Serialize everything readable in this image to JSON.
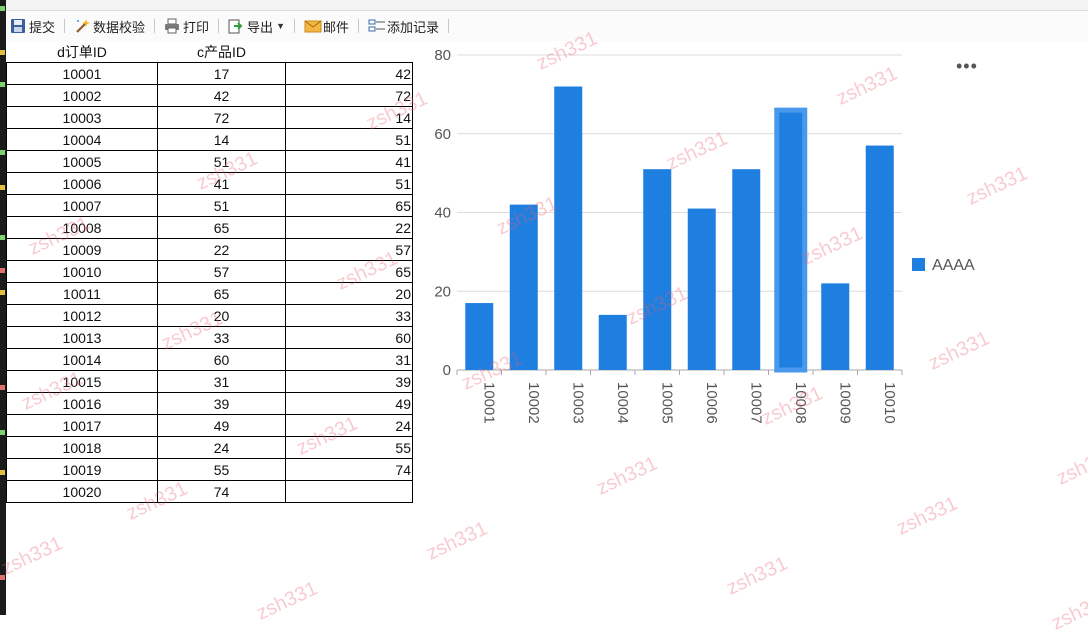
{
  "toolbar": {
    "submit_label": "提交",
    "validate_label": "数据校验",
    "print_label": "打印",
    "export_label": "导出",
    "mail_label": "邮件",
    "add_record_label": "添加记录"
  },
  "table": {
    "headers": [
      "d订单ID",
      "c产品ID",
      ""
    ],
    "rows": [
      [
        "10001",
        "17",
        "42"
      ],
      [
        "10002",
        "42",
        "72"
      ],
      [
        "10003",
        "72",
        "14"
      ],
      [
        "10004",
        "14",
        "51"
      ],
      [
        "10005",
        "51",
        "41"
      ],
      [
        "10006",
        "41",
        "51"
      ],
      [
        "10007",
        "51",
        "65"
      ],
      [
        "10008",
        "65",
        "22"
      ],
      [
        "10009",
        "22",
        "57"
      ],
      [
        "10010",
        "57",
        "65"
      ],
      [
        "10011",
        "65",
        "20"
      ],
      [
        "10012",
        "20",
        "33"
      ],
      [
        "10013",
        "33",
        "60"
      ],
      [
        "10014",
        "60",
        "31"
      ],
      [
        "10015",
        "31",
        "39"
      ],
      [
        "10016",
        "39",
        "49"
      ],
      [
        "10017",
        "49",
        "24"
      ],
      [
        "10018",
        "24",
        "55"
      ],
      [
        "10019",
        "55",
        "74"
      ],
      [
        "10020",
        "74",
        ""
      ]
    ]
  },
  "chart_data": {
    "type": "bar",
    "categories": [
      "10001",
      "10002",
      "10003",
      "10004",
      "10005",
      "10006",
      "10007",
      "10008",
      "10009",
      "10010"
    ],
    "series": [
      {
        "name": "AAAA",
        "values": [
          17,
          42,
          72,
          14,
          51,
          41,
          51,
          66,
          22,
          57
        ]
      }
    ],
    "ylim": [
      0,
      80
    ],
    "yticks": [
      "0",
      "20",
      "40",
      "60",
      "80"
    ],
    "grid": true,
    "legend": "right",
    "color": "#1e7fe0",
    "highlight_color": "#4a98ec"
  },
  "chart_menu_icon": "more-dots-icon",
  "watermark_text": "zsh331"
}
